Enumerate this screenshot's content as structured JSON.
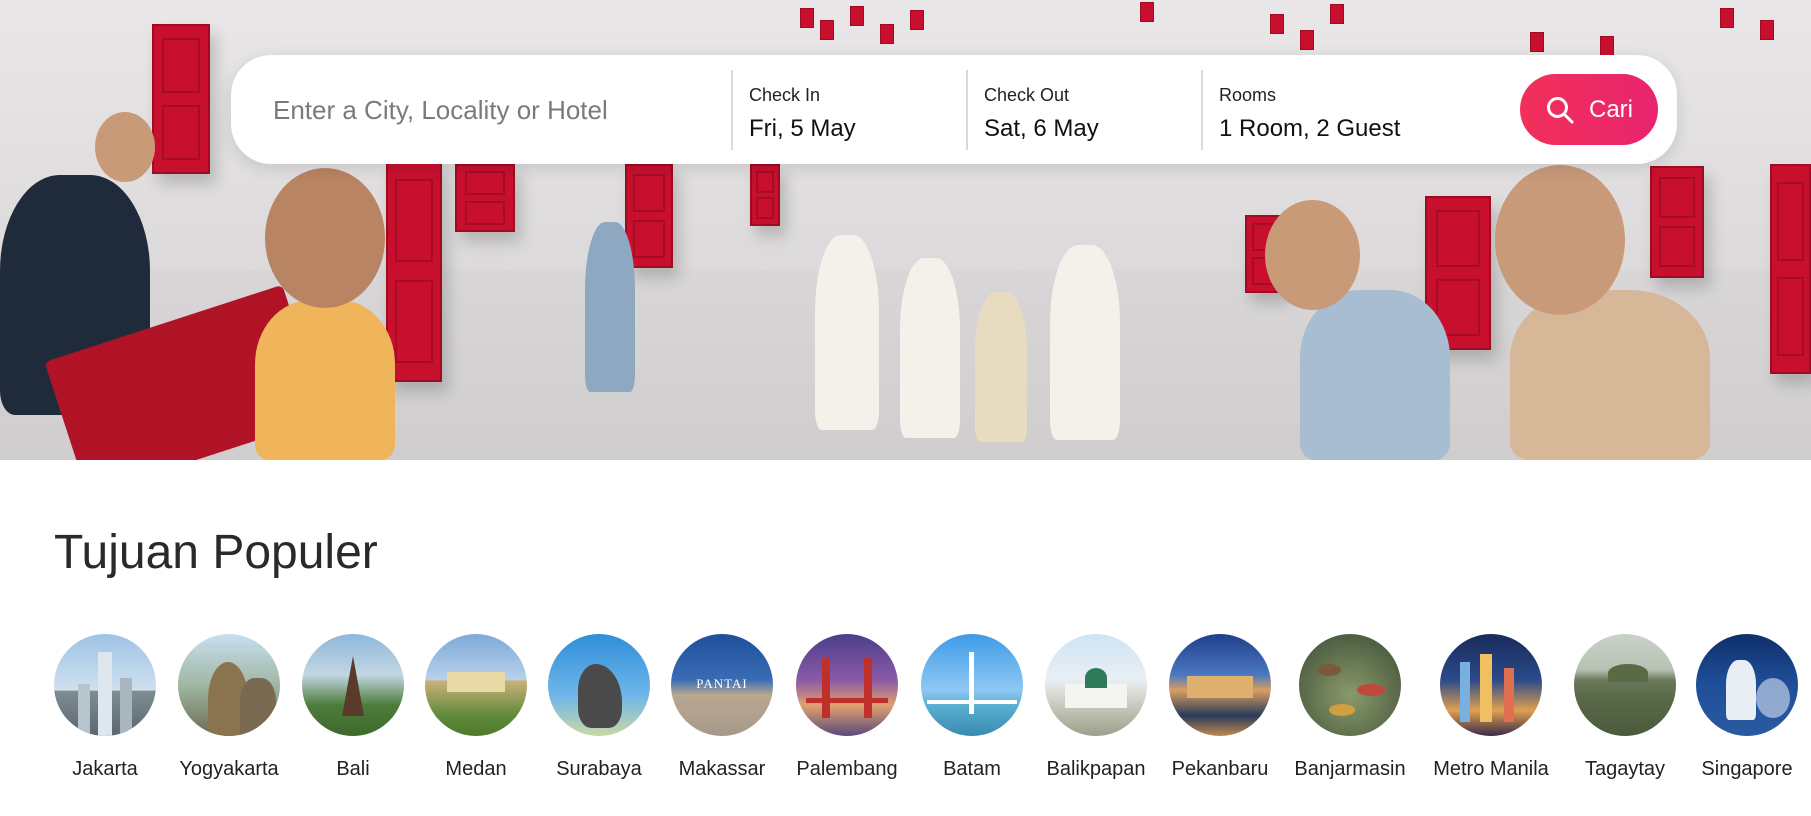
{
  "search": {
    "placeholder": "Enter a City, Locality or Hotel",
    "check_in_label": "Check In",
    "check_in_value": "Fri, 5 May",
    "check_out_label": "Check Out",
    "check_out_value": "Sat, 6 May",
    "rooms_label": "Rooms",
    "rooms_value": "1 Room, 2 Guest",
    "button_label": "Cari",
    "button_icon": "search-icon"
  },
  "popular": {
    "title": "Tujuan Populer",
    "destinations": [
      {
        "name": "Jakarta"
      },
      {
        "name": "Yogyakarta"
      },
      {
        "name": "Bali"
      },
      {
        "name": "Medan"
      },
      {
        "name": "Surabaya"
      },
      {
        "name": "Makassar"
      },
      {
        "name": "Palembang"
      },
      {
        "name": "Batam"
      },
      {
        "name": "Balikpapan"
      },
      {
        "name": "Pekanbaru"
      },
      {
        "name": "Banjarmasin"
      },
      {
        "name": "Metro Manila"
      },
      {
        "name": "Tagaytay"
      },
      {
        "name": "Singapore"
      }
    ],
    "thumb_text": {
      "makassar": "PANTAI"
    }
  },
  "colors": {
    "accent": "#f2305a",
    "door_red": "#c8102e"
  }
}
